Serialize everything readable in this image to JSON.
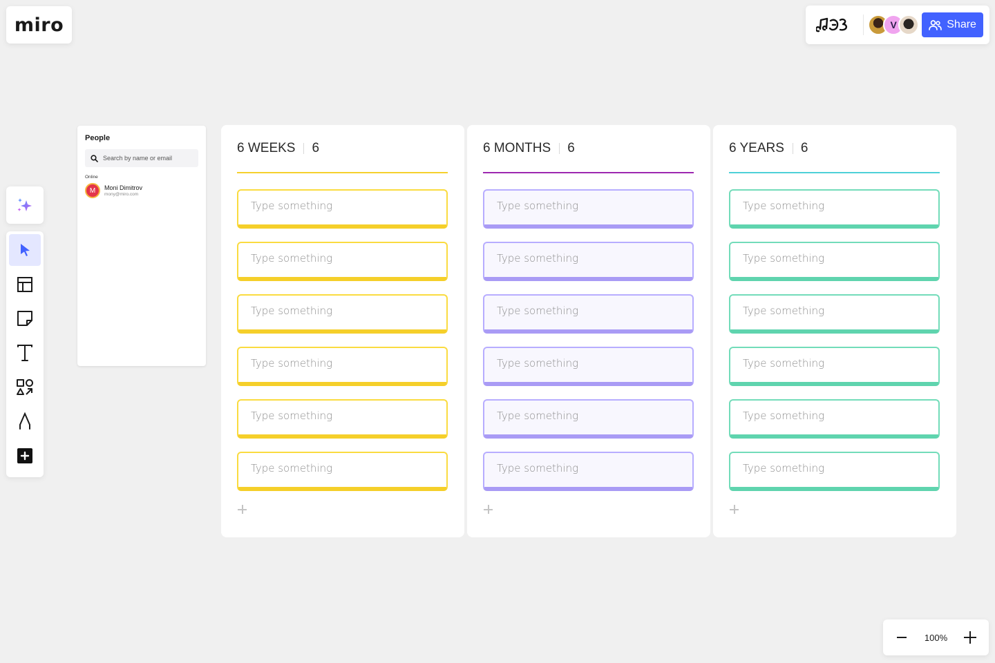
{
  "logo": {
    "text": "miro"
  },
  "topbar": {
    "board_icon": "music-notes-board-icon",
    "avatars": [
      {
        "name": "collaborator-1",
        "initial": ""
      },
      {
        "name": "collaborator-v",
        "initial": "V"
      },
      {
        "name": "collaborator-3",
        "initial": ""
      }
    ],
    "share_label": "Share"
  },
  "toolbar": {
    "ai_tool": "sparkle-icon",
    "tools": [
      {
        "id": "select",
        "icon": "cursor-icon",
        "active": true
      },
      {
        "id": "templates",
        "icon": "layout-icon",
        "active": false
      },
      {
        "id": "sticky-note",
        "icon": "sticky-note-icon",
        "active": false
      },
      {
        "id": "text",
        "icon": "text-icon",
        "active": false
      },
      {
        "id": "shapes",
        "icon": "shapes-icon",
        "active": false
      },
      {
        "id": "pen",
        "icon": "pen-icon",
        "active": false
      },
      {
        "id": "more",
        "icon": "plus-square-icon",
        "active": false
      }
    ]
  },
  "people": {
    "title": "People",
    "search_placeholder": "Search by name or email",
    "online_label": "Online",
    "members": [
      {
        "initial": "M",
        "name": "Moni Dimitrov",
        "email": "mony@miro.com"
      }
    ]
  },
  "columns": [
    {
      "title": "6 WEEKS",
      "count": "6",
      "accent": "#f5d02c",
      "card_border": "#fadb3f",
      "card_bottom": "#f5cf2a",
      "card_bg": "#ffffff",
      "cards": [
        "",
        "",
        "",
        "",
        "",
        ""
      ],
      "card_placeholder": "Type something"
    },
    {
      "title": "6 MONTHS",
      "count": "6",
      "accent": "#9c27b0",
      "card_border": "#b7adff",
      "card_bottom": "#a99bf5",
      "card_bg": "#f8f7fe",
      "cards": [
        "",
        "",
        "",
        "",
        "",
        ""
      ],
      "card_placeholder": "Type something"
    },
    {
      "title": "6 YEARS",
      "count": "6",
      "accent": "#4dd0d8",
      "card_border": "#72dcb9",
      "card_bottom": "#5fd4ae",
      "card_bg": "#ffffff",
      "cards": [
        "",
        "",
        "",
        "",
        "",
        ""
      ],
      "card_placeholder": "Type something"
    }
  ],
  "zoom": {
    "value": "100%"
  }
}
